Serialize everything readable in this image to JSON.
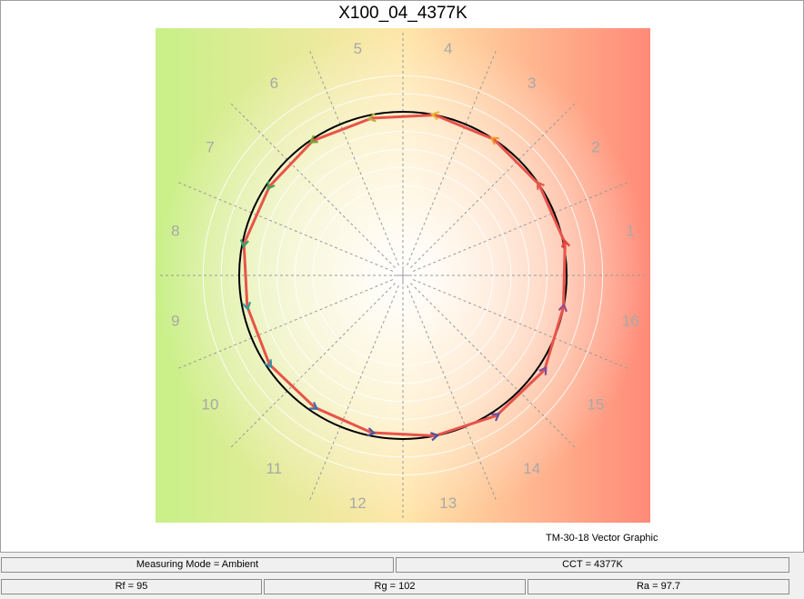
{
  "title": "X100_04_4377K",
  "caption": "TM-30-18 Vector Graphic",
  "status": {
    "measuring_mode": "Measuring Mode = Ambient",
    "cct": "CCT = 4377K",
    "rf": "Rf = 95",
    "rg": "Rg = 102",
    "ra": "Ra = 97.7"
  },
  "chart_data": {
    "type": "polar",
    "title": "X100_04_4377K",
    "bins": [
      "1",
      "2",
      "3",
      "4",
      "5",
      "6",
      "7",
      "8",
      "9",
      "10",
      "11",
      "12",
      "13",
      "14",
      "15",
      "16"
    ],
    "reference_radius": 1.0,
    "test_radius": [
      1.01,
      1.0,
      1.0,
      1.0,
      0.98,
      0.99,
      0.98,
      0.99,
      0.97,
      0.98,
      0.97,
      0.98,
      1.0,
      1.03,
      1.04,
      1.0
    ],
    "bin_colors": [
      "#e0403a",
      "#e05a4a",
      "#f59a2a",
      "#e8b832",
      "#b8b040",
      "#70a838",
      "#40a050",
      "#30a070",
      "#30a098",
      "#3090a8",
      "#4070b0",
      "#4858a0",
      "#4a52a0",
      "#6a50a0",
      "#8050a0",
      "#a04888"
    ],
    "reference_color": "#000000",
    "test_color": "#e8534a",
    "grid": true
  }
}
